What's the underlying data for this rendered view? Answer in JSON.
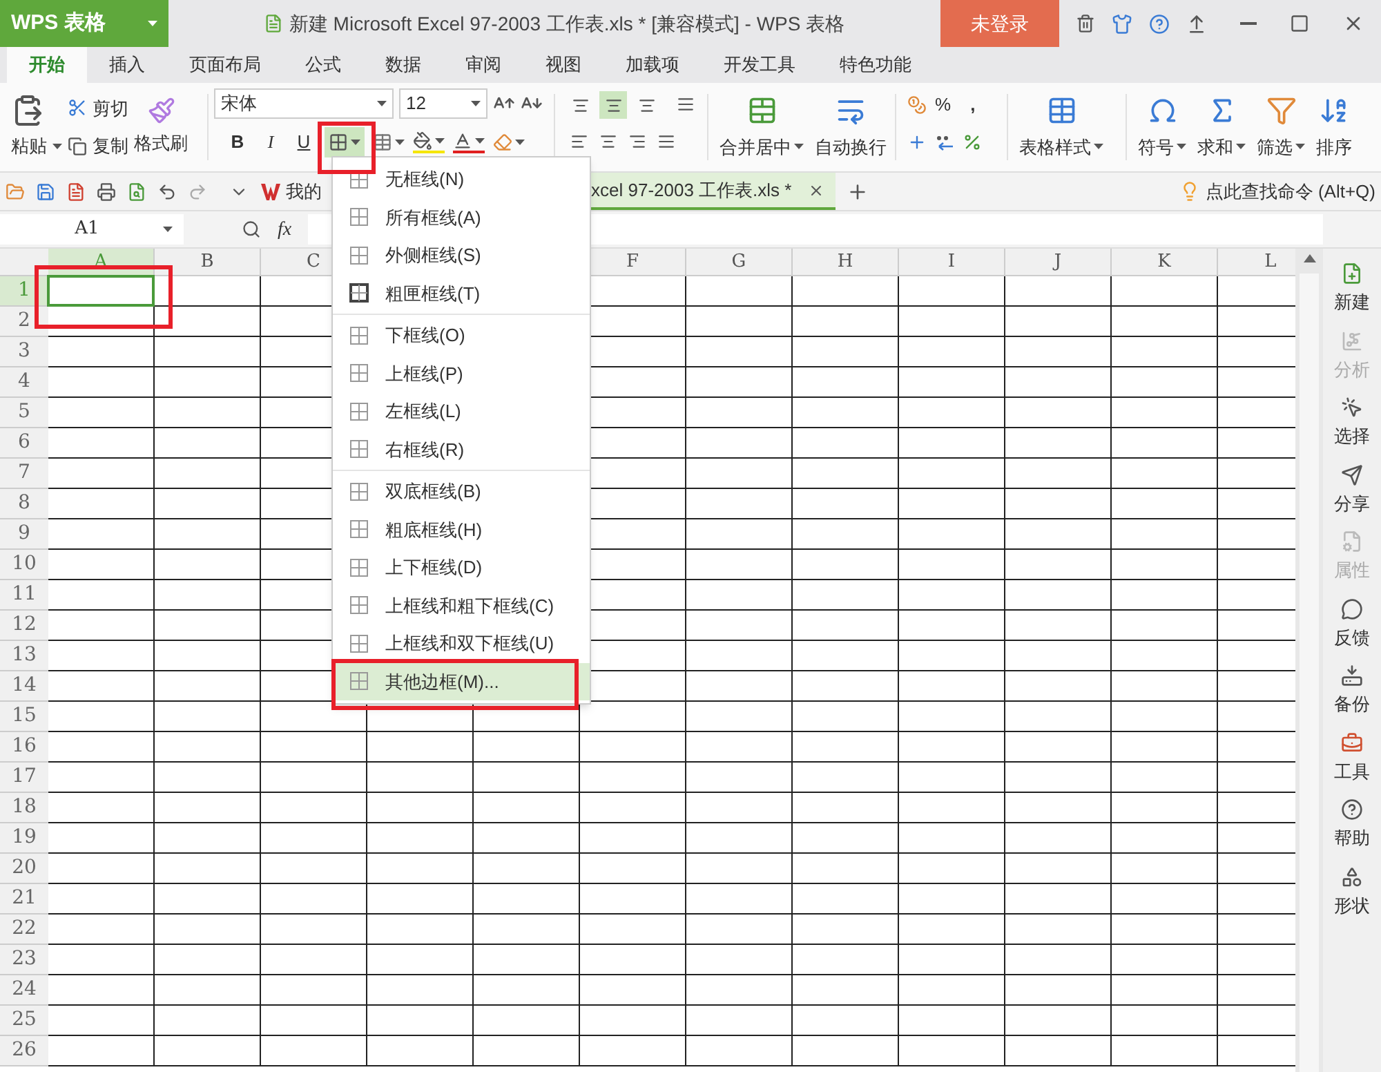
{
  "app_menu": {
    "label": "WPS 表格"
  },
  "title": "新建 Microsoft Excel 97-2003 工作表.xls * [兼容模式] - WPS 表格",
  "login_button": "未登录",
  "tabs": [
    {
      "label": "开始",
      "selected": true
    },
    {
      "label": "插入",
      "selected": false
    },
    {
      "label": "页面布局",
      "selected": false
    },
    {
      "label": "公式",
      "selected": false
    },
    {
      "label": "数据",
      "selected": false
    },
    {
      "label": "审阅",
      "selected": false
    },
    {
      "label": "视图",
      "selected": false
    },
    {
      "label": "加载项",
      "selected": false
    },
    {
      "label": "开发工具",
      "selected": false
    },
    {
      "label": "特色功能",
      "selected": false
    }
  ],
  "ribbon": {
    "paste": "粘贴",
    "cut": "剪切",
    "copy": "复制",
    "format_painter": "格式刷",
    "font_name": "宋体",
    "font_size": "12",
    "bold": "B",
    "italic": "I",
    "underline": "U",
    "border_button": {
      "active": true
    },
    "valign": [
      {
        "selected": false
      },
      {
        "selected": true
      },
      {
        "selected": false
      }
    ],
    "merge": "合并居中",
    "wrap": "自动换行",
    "percent": "%",
    "comma": ",",
    "table_style": "表格样式",
    "symbol": "符号",
    "sum": "求和",
    "filter": "筛选",
    "sort": "排序"
  },
  "doc_tabs": [
    {
      "label": "我的",
      "selected": false
    },
    {
      "label": "xcel 97-2003 工作表.xls *",
      "selected": true
    }
  ],
  "command_search": "点此查找命令 (Alt+Q)",
  "name_box": "A1",
  "fx": "fx",
  "columns": [
    {
      "label": "A",
      "selected": true
    },
    {
      "label": "B",
      "selected": false
    },
    {
      "label": "C",
      "selected": false
    },
    {
      "label": "F",
      "selected": false
    },
    {
      "label": "G",
      "selected": false
    },
    {
      "label": "H",
      "selected": false
    },
    {
      "label": "I",
      "selected": false
    },
    {
      "label": "J",
      "selected": false
    },
    {
      "label": "K",
      "selected": false
    },
    {
      "label": "L",
      "selected": false
    }
  ],
  "rows": [
    {
      "label": "1",
      "selected": true
    },
    {
      "label": "2",
      "selected": false
    },
    {
      "label": "3",
      "selected": false
    },
    {
      "label": "4",
      "selected": false
    },
    {
      "label": "5",
      "selected": false
    },
    {
      "label": "6",
      "selected": false
    },
    {
      "label": "7",
      "selected": false
    },
    {
      "label": "8",
      "selected": false
    },
    {
      "label": "9",
      "selected": false
    },
    {
      "label": "10",
      "selected": false
    },
    {
      "label": "11",
      "selected": false
    },
    {
      "label": "12",
      "selected": false
    },
    {
      "label": "13",
      "selected": false
    },
    {
      "label": "14",
      "selected": false
    },
    {
      "label": "15",
      "selected": false
    },
    {
      "label": "16",
      "selected": false
    },
    {
      "label": "17",
      "selected": false
    },
    {
      "label": "18",
      "selected": false
    },
    {
      "label": "19",
      "selected": false
    },
    {
      "label": "20",
      "selected": false
    },
    {
      "label": "21",
      "selected": false
    },
    {
      "label": "22",
      "selected": false
    },
    {
      "label": "23",
      "selected": false
    },
    {
      "label": "24",
      "selected": false
    },
    {
      "label": "25",
      "selected": false
    },
    {
      "label": "26",
      "selected": false
    }
  ],
  "border_menu": {
    "groups": [
      [
        {
          "label": "无框线(N)",
          "selected": false
        },
        {
          "label": "所有框线(A)",
          "selected": false
        },
        {
          "label": "外侧框线(S)",
          "selected": false
        },
        {
          "label": "粗匣框线(T)",
          "selected": false
        }
      ],
      [
        {
          "label": "下框线(O)",
          "selected": false
        },
        {
          "label": "上框线(P)",
          "selected": false
        },
        {
          "label": "左框线(L)",
          "selected": false
        },
        {
          "label": "右框线(R)",
          "selected": false
        }
      ],
      [
        {
          "label": "双底框线(B)",
          "selected": false
        },
        {
          "label": "粗底框线(H)",
          "selected": false
        },
        {
          "label": "上下框线(D)",
          "selected": false
        },
        {
          "label": "上框线和粗下框线(C)",
          "selected": false
        },
        {
          "label": "上框线和双下框线(U)",
          "selected": false
        },
        {
          "label": "其他边框(M)...",
          "selected": true
        }
      ]
    ]
  },
  "sidebar": [
    {
      "label": "新建",
      "disabled": false
    },
    {
      "label": "分析",
      "disabled": true
    },
    {
      "label": "选择",
      "disabled": false
    },
    {
      "label": "分享",
      "disabled": false
    },
    {
      "label": "属性",
      "disabled": true
    },
    {
      "label": "反馈",
      "disabled": false
    },
    {
      "label": "备份",
      "disabled": false
    },
    {
      "label": "工具",
      "disabled": false
    },
    {
      "label": "帮助",
      "disabled": false
    },
    {
      "label": "形状",
      "disabled": false
    }
  ]
}
